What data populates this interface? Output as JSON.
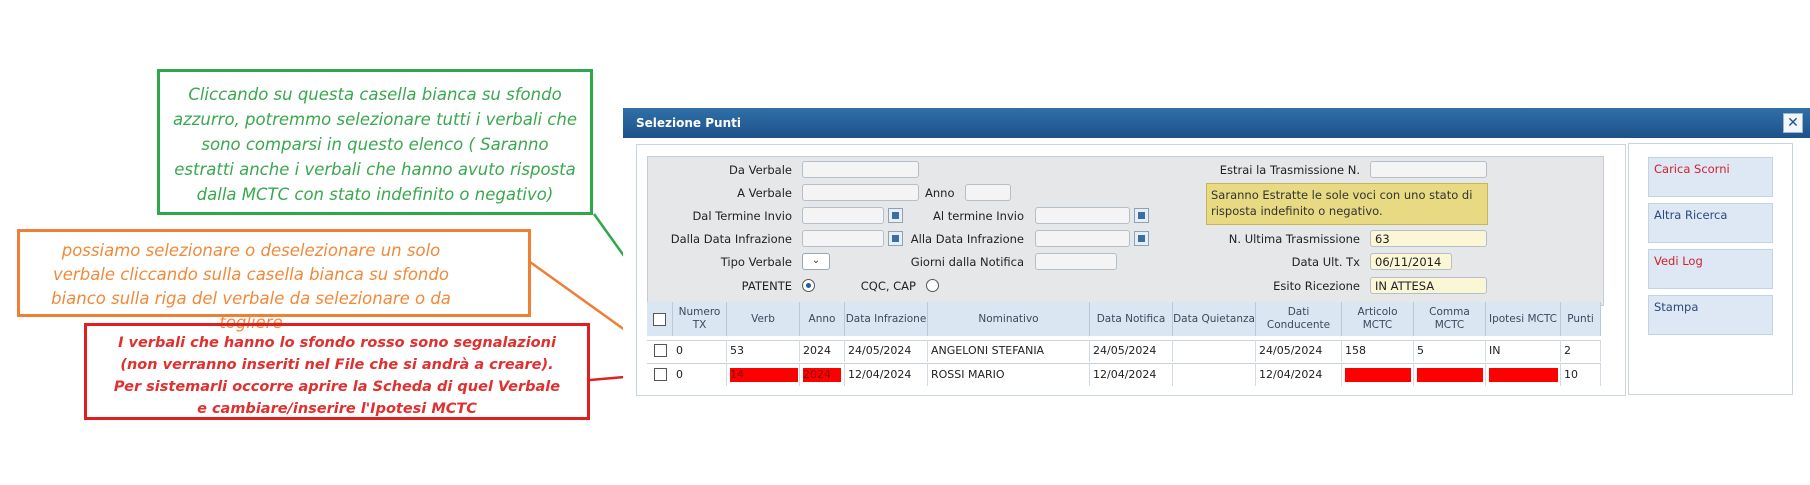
{
  "callouts": {
    "green": "Cliccando su questa casella bianca su sfondo azzurro, potremmo selezionare tutti i verbali che sono comparsi in questo elenco ( Saranno estratti anche i verbali che hanno avuto risposta dalla MCTC con stato indefinito o negativo)",
    "orange": "possiamo selezionare o deselezionare un solo verbale cliccando sulla casella bianca su sfondo bianco  sulla riga del verbale da selezionare o da togliere",
    "red": "I verbali che hanno lo sfondo rosso sono segnalazioni (non verranno inseriti nel File che si andrà a creare). Per sistemarli occorre aprire la Scheda di quel Verbale e cambiare/inserire l'Ipotesi MCTC"
  },
  "dialog": {
    "title": "Selezione Punti",
    "close": "✕"
  },
  "filters": {
    "da_verbale": "Da Verbale",
    "a_verbale": "A Verbale",
    "anno": "Anno",
    "dal_termine_invio": "Dal Termine Invio",
    "al_termine_invio": "Al termine Invio",
    "dalla_data_infrazione": "Dalla Data Infrazione",
    "alla_data_infrazione": "Alla Data Infrazione",
    "tipo_verbale": "Tipo Verbale",
    "tipo_verbale_value": "⌄",
    "giorni_dalla_notifica": "Giorni dalla Notifica",
    "patente": "PATENTE",
    "cqc_cap": "CQC, CAP",
    "estrai_trasmissione": "Estrai la Trasmissione N.",
    "note": "Saranno Estratte le sole voci con uno stato di risposta indefinito o negativo.",
    "ultima_trasmissione_label": "N. Ultima Trasmissione",
    "ultima_trasmissione_value": "63",
    "data_ult_tx_label": "Data Ult. Tx",
    "data_ult_tx_value": "06/11/2014",
    "esito_ricezione_label": "Esito Ricezione",
    "esito_ricezione_value": "IN ATTESA"
  },
  "table": {
    "headers": [
      "Numero TX",
      "Verb",
      "Anno",
      "Data Infrazione",
      "Nominativo",
      "Data Notifica",
      "Data Quietanza",
      "Dati Conducente",
      "Articolo MCTC",
      "Comma MCTC",
      "Ipotesi MCTC",
      "Punti"
    ],
    "rows": [
      [
        "0",
        "53",
        "2024",
        "24/05/2024",
        "ANGELONI STEFANIA",
        "24/05/2024",
        "",
        "24/05/2024",
        "158",
        "5",
        "IN",
        "2"
      ],
      [
        "0",
        "14",
        "2024",
        "12/04/2024",
        "ROSSI MARIO",
        "12/04/2024",
        "",
        "12/04/2024",
        "",
        "",
        "",
        "10"
      ]
    ]
  },
  "side": {
    "carica_scorni": "Carica Scorni",
    "altra_ricerca": "Altra Ricerca",
    "vedi_log": "Vedi Log",
    "stampa": "Stampa"
  },
  "colors": {
    "green_callout": "#2ea84a",
    "orange_callout": "#ee7f34",
    "red_callout": "#e02020",
    "titlebar": "#1f5289",
    "error_cell": "#ff0000"
  }
}
